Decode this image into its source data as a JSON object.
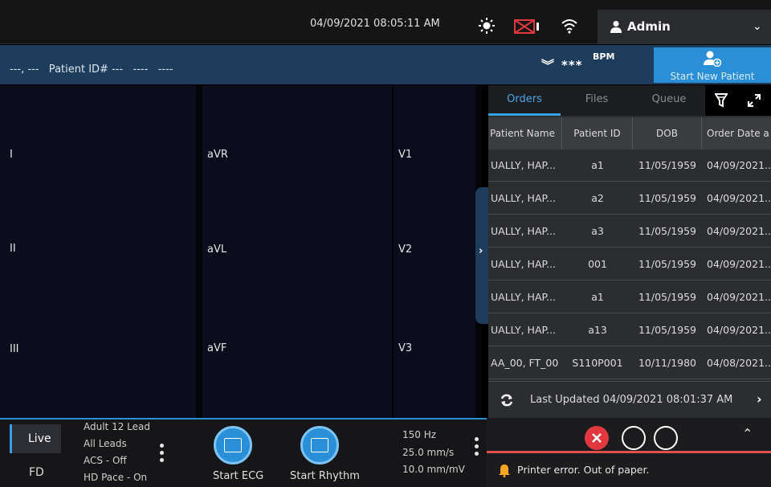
{
  "topbar": {
    "datetime": "04/09/2021 08:05:11 AM",
    "icons": [
      "sun-icon",
      "mail-error-icon",
      "wifi-icon"
    ],
    "user": {
      "name": "Admin",
      "icon": "user-icon"
    }
  },
  "patient": {
    "info": "---, ---   Patient ID# ---   ----   ----",
    "bpm_value": "***",
    "bpm_unit": "BPM",
    "start_new_label": "Start New Patient"
  },
  "leads": {
    "col1": [
      "I",
      "II",
      "III"
    ],
    "col2": [
      "aVR",
      "aVL",
      "aVF"
    ],
    "col3": [
      "V1",
      "V2",
      "V3"
    ]
  },
  "orders_panel": {
    "tabs": [
      {
        "label": "Orders",
        "active": true
      },
      {
        "label": "Files",
        "active": false
      },
      {
        "label": "Queue",
        "active": false
      }
    ],
    "columns": [
      "Patient Name",
      "Patient ID",
      "DOB",
      "Order Date a"
    ],
    "rows": [
      {
        "name": "UALLY, HAP...",
        "id": "a1",
        "dob": "11/05/1959",
        "date": "04/09/2021..."
      },
      {
        "name": "UALLY, HAP...",
        "id": "a2",
        "dob": "11/05/1959",
        "date": "04/09/2021..."
      },
      {
        "name": "UALLY, HAP...",
        "id": "a3",
        "dob": "11/05/1959",
        "date": "04/09/2021..."
      },
      {
        "name": "UALLY, HAP...",
        "id": "001",
        "dob": "11/05/1959",
        "date": "04/09/2021..."
      },
      {
        "name": "UALLY, HAP...",
        "id": "a1",
        "dob": "11/05/1959",
        "date": "04/09/2021..."
      },
      {
        "name": "UALLY, HAP...",
        "id": "a13",
        "dob": "11/05/1959",
        "date": "04/09/2021..."
      },
      {
        "name": "AA_00, FT_00",
        "id": "S110P001",
        "dob": "10/11/1980",
        "date": "04/08/2021..."
      }
    ],
    "last_updated": "Last Updated 04/09/2021 08:01:37 AM"
  },
  "bottombar": {
    "modes": [
      "Live",
      "FD"
    ],
    "settings": [
      "Adult 12 Lead",
      "All Leads",
      "ACS - Off",
      "HD Pace - On"
    ],
    "start_ecg_label": "Start ECG",
    "start_rhythm_label": "Start Rhythm",
    "rates": [
      "150 Hz",
      "25.0 mm/s",
      "10.0 mm/mV"
    ]
  },
  "status": {
    "message": "Printer error. Out of paper.",
    "error_color": "#e0383e",
    "accent_color": "#2a8fd6"
  }
}
